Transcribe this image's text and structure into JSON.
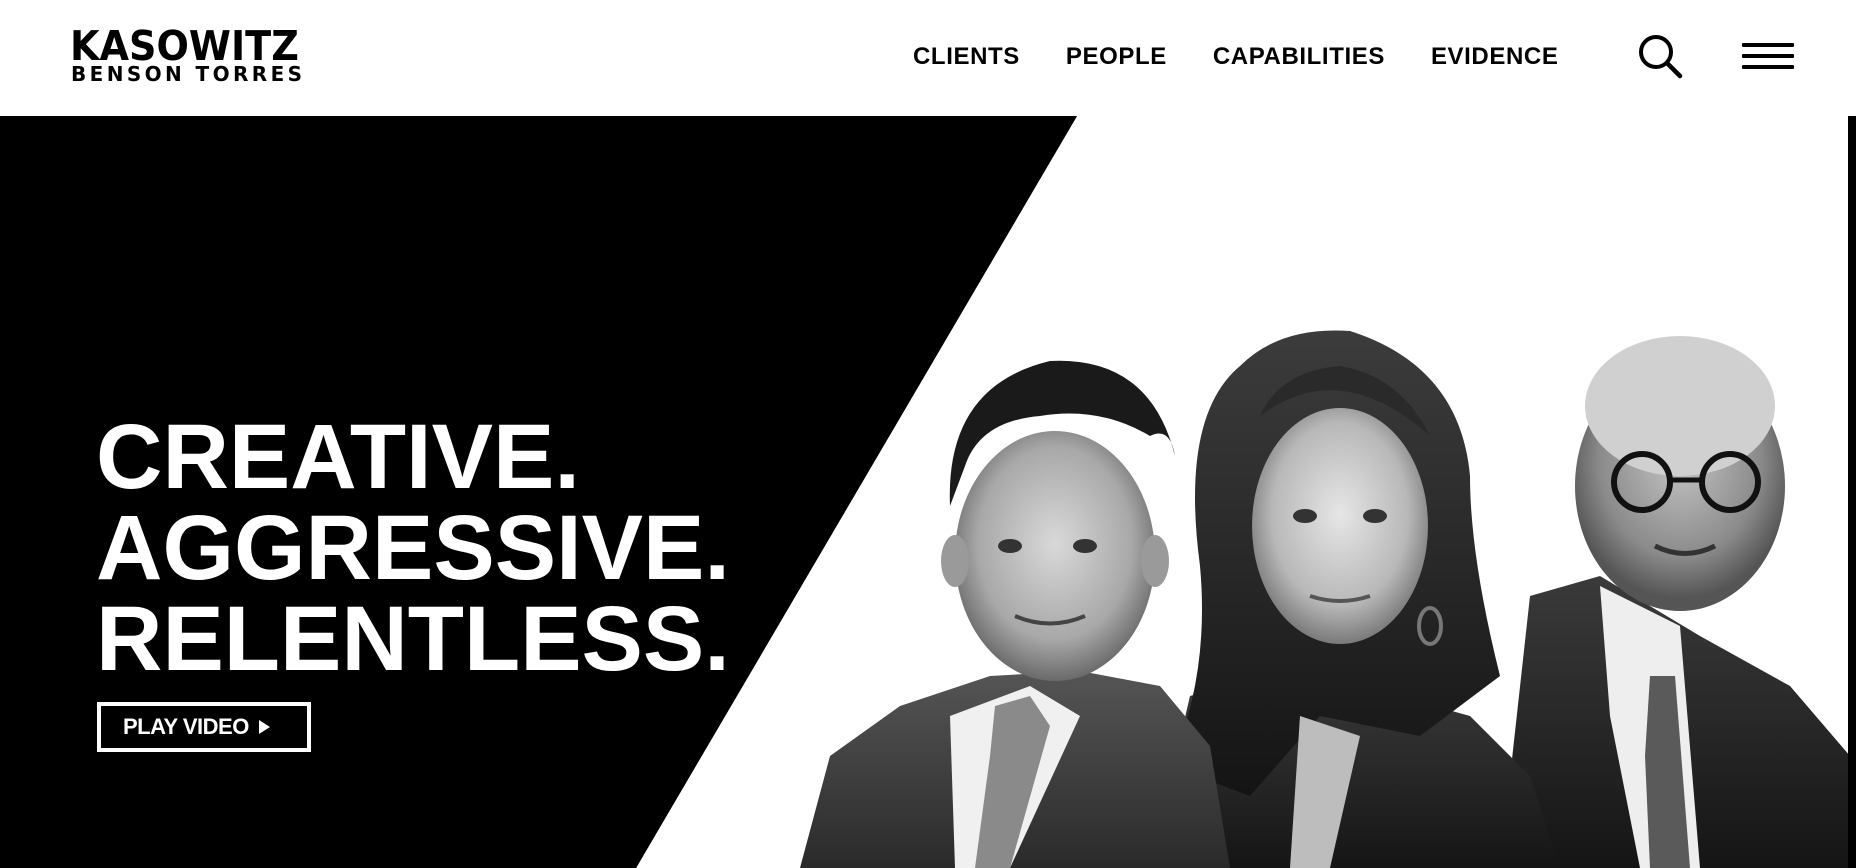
{
  "brand": {
    "name_top": "KASOWITZ",
    "name_bottom": "BENSON TORRES"
  },
  "nav": {
    "items": [
      {
        "label": "CLIENTS"
      },
      {
        "label": "PEOPLE"
      },
      {
        "label": "CAPABILITIES"
      },
      {
        "label": "EVIDENCE"
      }
    ],
    "search_icon": "search-icon",
    "menu_icon": "hamburger-menu-icon"
  },
  "hero": {
    "headline": [
      "CREATIVE.",
      "AGGRESSIVE.",
      "RELENTLESS."
    ],
    "play_video_label": "PLAY VIDEO",
    "play_icon": "play-triangle-icon"
  },
  "colors": {
    "primary": "#000000",
    "background": "#ffffff",
    "text_on_dark": "#ffffff"
  }
}
